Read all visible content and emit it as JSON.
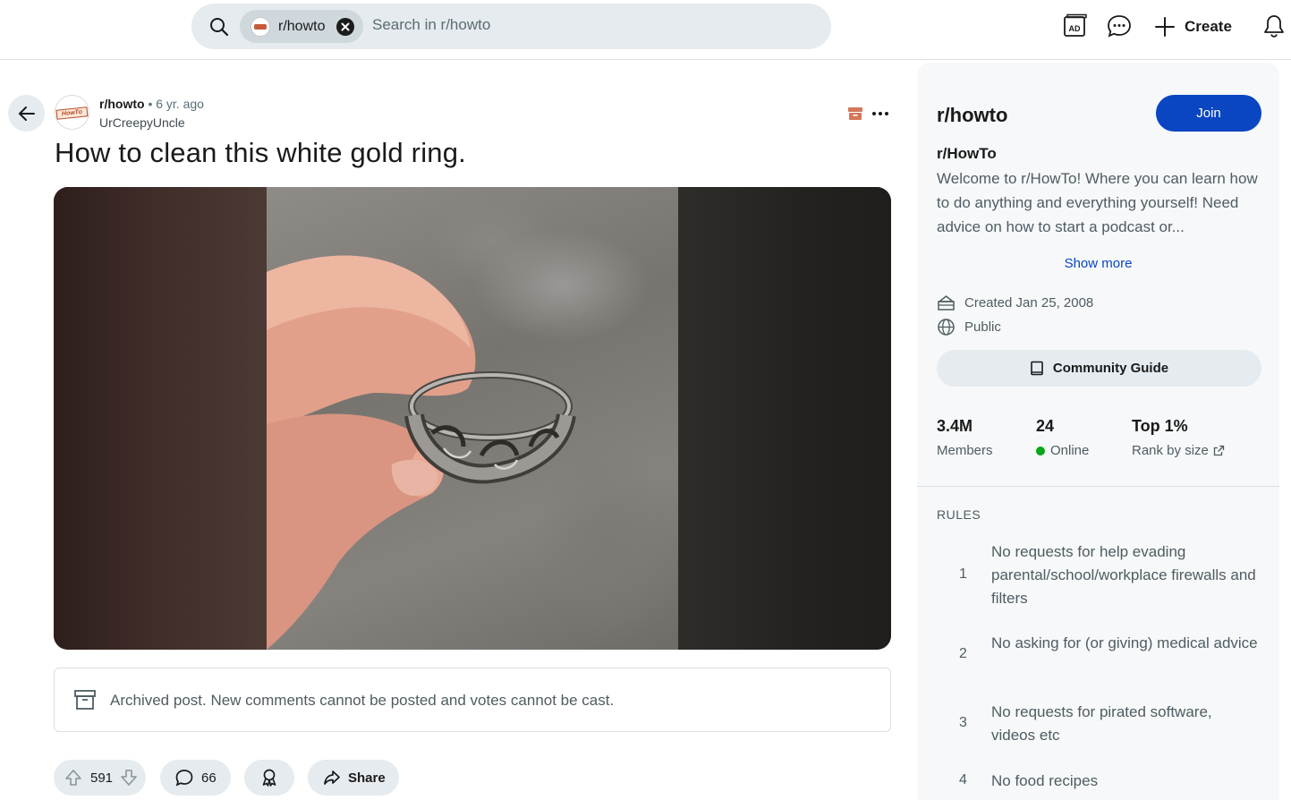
{
  "header": {
    "search": {
      "scope_chip_label": "r/howto",
      "placeholder": "Search in r/howto"
    },
    "create_label": "Create",
    "icons": [
      "ad-icon",
      "chat-icon",
      "plus-icon",
      "notification-bell-icon"
    ]
  },
  "post": {
    "subreddit": "r/howto",
    "separator": "•",
    "age": "6 yr. ago",
    "author": "UrCreepyUncle",
    "avatar_logo": "HowTo",
    "title": "How to clean this white gold ring.",
    "archived_notice": "Archived post. New comments cannot be posted and votes cannot be cast.",
    "actions": {
      "votes": "591",
      "comments": "66",
      "share_label": "Share"
    }
  },
  "sidebar": {
    "name": "r/howto",
    "join_label": "Join",
    "title": "r/HowTo",
    "description": "Welcome to r/HowTo! Where you can learn how to do anything and everything yourself! Need advice on how to start a podcast or...",
    "show_more_label": "Show more",
    "created": "Created Jan 25, 2008",
    "visibility": "Public",
    "guide_label": "Community Guide",
    "stats": [
      {
        "value": "3.4M",
        "label": "Members"
      },
      {
        "value": "24",
        "label": "Online"
      },
      {
        "value": "Top 1%",
        "label": "Rank by size"
      }
    ],
    "rules_heading": "RULES",
    "rules": [
      {
        "num": "1",
        "text": "No requests for help evading parental/school/workplace firewalls and filters"
      },
      {
        "num": "2",
        "text": "No asking for (or giving) medical advice"
      },
      {
        "num": "3",
        "text": "No requests for pirated software, videos etc"
      },
      {
        "num": "4",
        "text": "No food recipes"
      }
    ]
  },
  "colors": {
    "accent": "#0a45c2",
    "online": "#01a816",
    "chip_bg": "#e5ebee"
  }
}
